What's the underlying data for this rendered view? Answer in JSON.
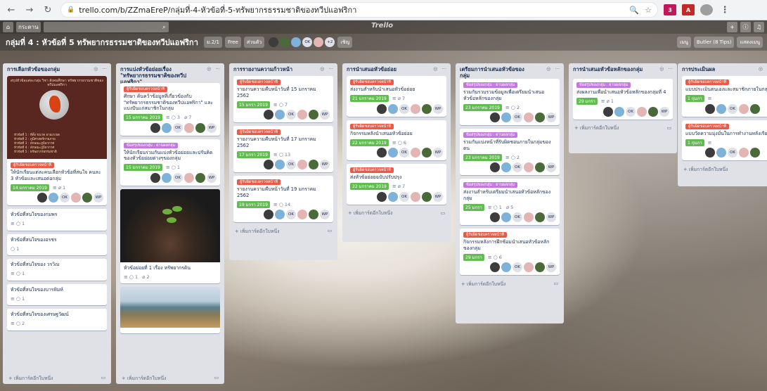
{
  "browser": {
    "url": "trello.com/b/ZZmaEreP/กลุ่มที่-4-หัวข้อที่-5-ทรัพยากรธรรมชาติของทวีปแอฟริกา",
    "ext_m_count": "3"
  },
  "appbar": {
    "boards_label": "กระดาน",
    "logo": "Trello",
    "home_glyph": "⌂",
    "search_glyph": "⌕",
    "plus_glyph": "+",
    "info_glyph": "ⓘ",
    "bell_glyph": "♫"
  },
  "board": {
    "title": "กลุ่มที่ 4 : หัวข้อที่ 5 ทรัพยากรธรรมชาติของทวีปแอฟริกา",
    "team_label": "ม.2/1",
    "free_badge": "Free",
    "visibility": "ส่วนตัว",
    "member_more": "+2",
    "invite": "เชิญ",
    "show_menu": "เมนู",
    "butler": "Butler (8 Tips)",
    "more_menu": "แสดงเมนู"
  },
  "colors": {
    "label_red": "#eb5a46",
    "label_purple": "#c377e0",
    "due_green": "#61bd4f",
    "list_bg": "#dfe1e6"
  },
  "add_card": "+ เพิ่มการ์ดอีกใบหนึ่ง",
  "lists": [
    {
      "title": "การเลือกหัวข้อของกลุ่ม",
      "cover": {
        "caption": "สรุปหัวข้อแต่ละกลุ่ม วิชา สังคมศึกษา ทรัพยากรธรรมชาติของทวีปแอฟริกา",
        "lines": [
          "หัวข้อที่ 1 : ที่ตั้ง ขนาด อาณาเขต",
          "หัวข้อที่ 2 : ภูมิศาสตร์กายภาพ",
          "หัวข้อที่ 3 : ลักษณะภูมิอากาศ",
          "หัวข้อที่ 4 : ลักษณะภูมิอากาศ",
          "หัวข้อที่ 5 : ทรัพยากรธรรมชาติ"
        ]
      },
      "card1": {
        "label": "ผู้รับผิดชอบครวจหน้าที่",
        "text": "ให้นักเรียนแต่ละคนเลือกหัวข้อที่สนใจ คนละ 3 หัวข้อและเสนอต่อกลุ่ม",
        "due": "14 มกราคม 2019",
        "comments": "1"
      },
      "simple_cards": [
        {
          "text": "หัวข้อที่สนใจของกมพร",
          "comments": "1"
        },
        {
          "text": "หัวข้อที่สนใจของอรชร",
          "comments": "1"
        },
        {
          "text": "หัวข้อที่สนใจของ วรวิณ",
          "comments": "1"
        },
        {
          "text": "หัวข้อที่สนใจของบารหิมห์",
          "comments": "1"
        },
        {
          "text": "หัวข้อที่สนใจของเศรษฐวัฒน์",
          "comments": "2"
        }
      ]
    },
    {
      "title": "การแบ่งหัวข้อย่อยเรื่อง \"ทรัพยากรธรรมชาติของทวีปแอฟริกา\"",
      "card1": {
        "label": "ผู้รับผิดชอบครวจหน้าที่",
        "text": "ศึกษา ค้นคว้าข้อมูลที่เกี่ยวข้องกับ \"ทรัพยากรธรรมชาติของทวีปแอฟริกา\" และแบ่งปันแก่สมาชิกในกลุ่ม",
        "due": "15 มกราคม 2019",
        "comments": "3",
        "attachments": "7"
      },
      "card2": {
        "label": "ข้อสรุปของกลุ่ม : ผ่านผลกลุ่ม",
        "text": "ให้นักเรียนร่วมกันแบ่งหัวข้อย่อยและปรับคิดของหัวข้อย่อยต่างๆของกลุ่ม",
        "due": "15 มกราคม 2019",
        "comments": "1"
      },
      "card3": {
        "text": "หัวข้อย่อยที่ 1 เรื่อง ทรัพยากรดิน",
        "comments": "1",
        "attachments": "2"
      }
    },
    {
      "title": "การรายงานความก้าวหน้า",
      "cards": [
        {
          "label": "ผู้รับผิดชอบครวจหน้าที่",
          "text": "รายงานความคืบหน้าวันที่ 15 มกราคม 2562",
          "due": "15 มกรา 2019",
          "comments": "7"
        },
        {
          "label": "ผู้รับผิดชอบครวจหน้าที่",
          "text": "รายงานความคืบหน้าวันที่ 17 มกราคม 2562",
          "due": "17 มกรา 2019",
          "comments": "13"
        },
        {
          "label": "ผู้รับผิดชอบครวจหน้าที่",
          "text": "รายงานความคืบหน้าวันที่ 19 มกราคม 2562",
          "due": "19 มกรา 2019",
          "comments": "14"
        }
      ]
    },
    {
      "title": "การนำเสนอหัวข้อย่อย",
      "cards": [
        {
          "label": "ผู้รับผิดชอบครวจหน้าที่",
          "text": "ส่งงานสำหรับนำเสนอหัวข้อย่อย",
          "due": "21 มกราคม 2019",
          "comments": "7"
        },
        {
          "label": "ผู้รับผิดชอบครวจหน้าที่",
          "text": "กิจกรรมหลังนำเสนอหัวข้อย่อย",
          "due": "22 มกราคม 2019",
          "comments": "6"
        },
        {
          "label": "ผู้รับผิดชอบครวจหน้าที่",
          "text": "ส่งหัวข้อย่อยฉบับปรับปรุง",
          "due": "22 มกราคม 2019",
          "comments": "7"
        }
      ]
    },
    {
      "title": "เตรียมการนำเสนอหัวข้อของกลุ่ม",
      "cards": [
        {
          "label": "ข้อสรุปของกลุ่ม : ผ่านผลกลุ่ม",
          "text": "ร่วมกันรวบรวมข้อมูลเพื่อเตรียมนำเสนอหัวข้อหลักของกลุ่ม",
          "due": "23 มกราคม 2019",
          "comments": "2"
        },
        {
          "label": "ข้อสรุปของกลุ่ม : ผ่านผลกลุ่ม",
          "text": "ร่วมกันแบ่งหน้าที่รับผิดชอบภายในกลุ่มของตน",
          "due": "23 มกราคม 2019",
          "comments": "2"
        },
        {
          "label": "ข้อสรุปของกลุ่ม : ผ่านผลกลุ่ม",
          "text": "ส่งงานสำหรับเตรียมนำเสนอหัวข้อหลักของกลุ่ม",
          "due": "25 มกรา",
          "comments": "1",
          "attachments": "5"
        },
        {
          "label": "ผู้รับผิดชอบครวจหน้าที่",
          "text": "กิจกรรมหลังการฝึกซ้อมนำเสนอหัวข้อหลักของกลุ่ม",
          "due": "29 มกรา",
          "comments": "6"
        }
      ]
    },
    {
      "title": "การนำเสนอหัวข้อหลักของกลุ่ม",
      "cards": [
        {
          "label": "ข้อสรุปของกลุ่ม : ผ่านผลกลุ่ม",
          "text": "ส่งผลงานเพื่อนำเสนอหัวข้อหลักของกลุ่มที่ 4",
          "due": "29 มกรา",
          "comments": "",
          "attachments": "1"
        }
      ]
    },
    {
      "title": "การประเมินผล",
      "cards": [
        {
          "label": "ผู้รับผิดชอบครวจหน้าที่",
          "text": "แบบประเมินตนเองและสมาชิกภายในกลุ่ม",
          "due": "1 กุมภา"
        },
        {
          "label": "ผู้รับผิดชอบครวจหน้าที่",
          "text": "แบบวัดความมุ่งมั่นในการทำงานหลังเรียน",
          "due": "1 กุมภา"
        }
      ]
    }
  ],
  "member_labels": {
    "ok": "OK",
    "wp": "WP"
  },
  "icons": {
    "desc": "≡",
    "comment": "○",
    "attach": "⌀",
    "clock": "⏲",
    "watch": "◎",
    "more": "···",
    "card_template": "▭"
  }
}
